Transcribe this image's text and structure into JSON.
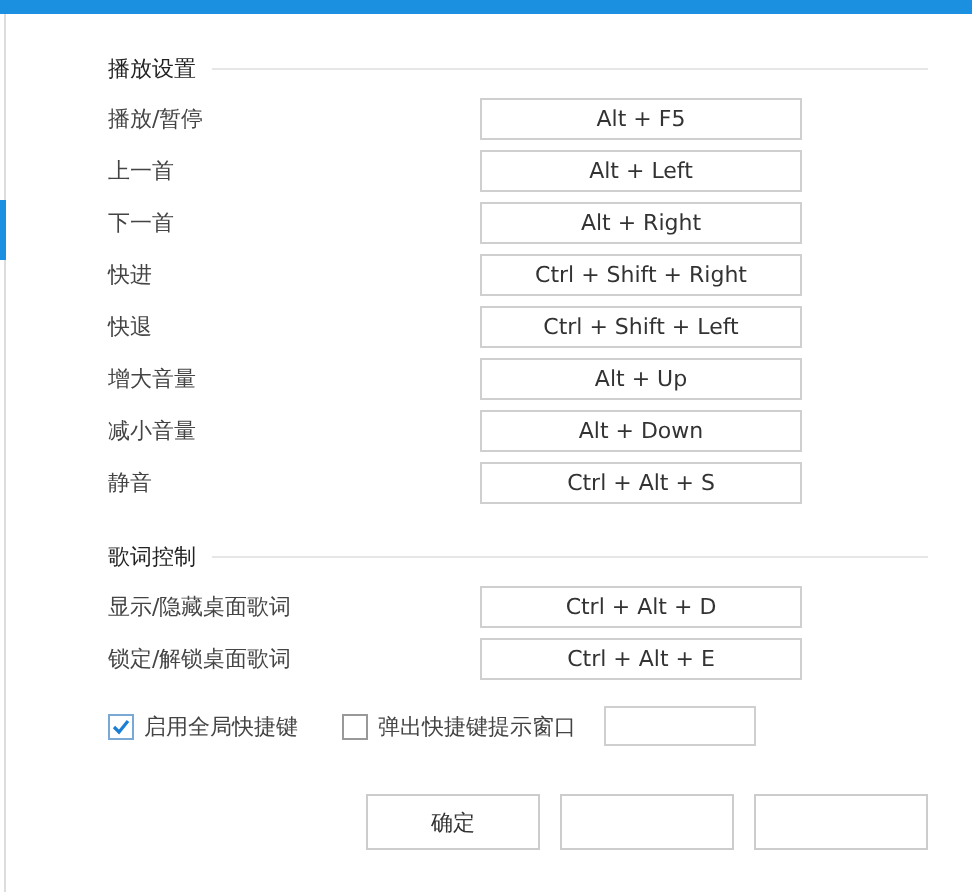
{
  "sections": [
    {
      "title": "播放设置",
      "rows": [
        {
          "label": "播放/暂停",
          "key": "Alt + F5"
        },
        {
          "label": "上一首",
          "key": "Alt + Left"
        },
        {
          "label": "下一首",
          "key": "Alt + Right"
        },
        {
          "label": "快进",
          "key": "Ctrl + Shift + Right"
        },
        {
          "label": "快退",
          "key": "Ctrl + Shift + Left"
        },
        {
          "label": "增大音量",
          "key": "Alt + Up"
        },
        {
          "label": "减小音量",
          "key": "Alt + Down"
        },
        {
          "label": "静音",
          "key": "Ctrl + Alt + S"
        }
      ]
    },
    {
      "title": "歌词控制",
      "rows": [
        {
          "label": "显示/隐藏桌面歌词",
          "key": "Ctrl + Alt + D"
        },
        {
          "label": "锁定/解锁桌面歌词",
          "key": "Ctrl + Alt + E"
        }
      ]
    }
  ],
  "options": [
    {
      "label": "启用全局快捷键",
      "checked": true,
      "kind": "checkbox"
    },
    {
      "label": "弹出快捷键提示窗口",
      "checked": false,
      "kind": "checkbox-field"
    }
  ],
  "buttons": [
    {
      "kind": "text",
      "label": "确定"
    },
    {
      "kind": "blank"
    },
    {
      "kind": "blank"
    }
  ]
}
